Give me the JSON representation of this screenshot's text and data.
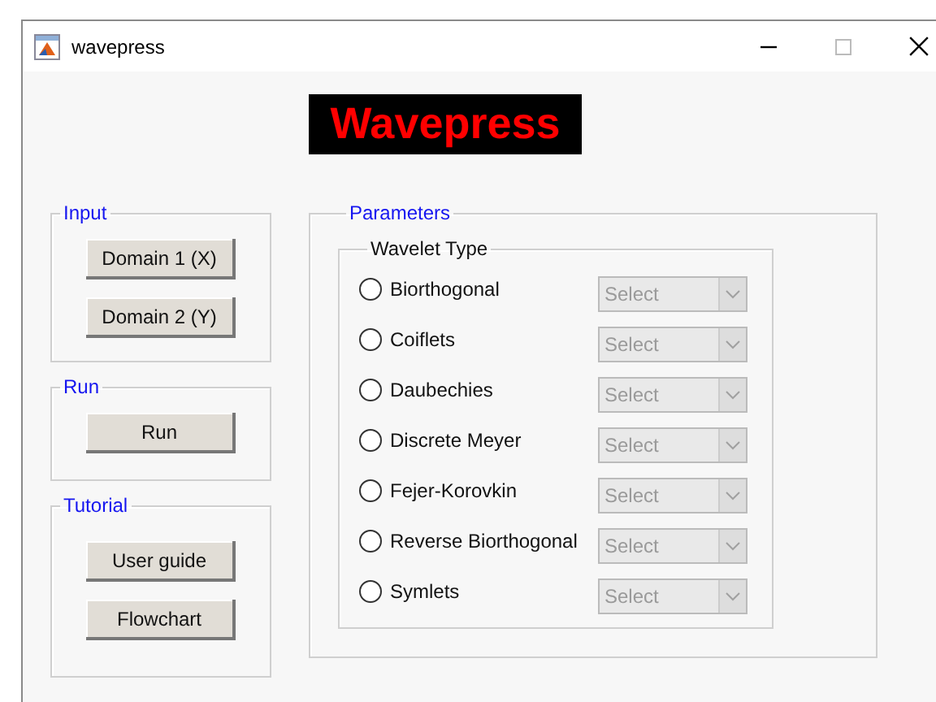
{
  "window": {
    "title": "wavepress",
    "controls": [
      {
        "kind": "minimize"
      },
      {
        "kind": "maximize"
      },
      {
        "kind": "close"
      }
    ]
  },
  "banner": "Wavepress",
  "side_panels": [
    {
      "title": "Input",
      "buttons": [
        "Domain 1 (X)",
        "Domain 2 (Y)"
      ]
    },
    {
      "title": "Run",
      "buttons": [
        "Run"
      ]
    },
    {
      "title": "Tutorial",
      "buttons": [
        "User guide",
        "Flowchart"
      ]
    }
  ],
  "parameters": {
    "title": "Parameters",
    "wavelet_type": {
      "title": "Wavelet Type",
      "options": [
        {
          "label": "Biorthogonal",
          "selected": false,
          "select": {
            "placeholder": "Select",
            "disabled": true
          }
        },
        {
          "label": "Coiflets",
          "selected": false,
          "select": {
            "placeholder": "Select",
            "disabled": true
          }
        },
        {
          "label": "Daubechies",
          "selected": false,
          "select": {
            "placeholder": "Select",
            "disabled": true
          }
        },
        {
          "label": "Discrete Meyer",
          "selected": false,
          "select": {
            "placeholder": "Select",
            "disabled": true
          }
        },
        {
          "label": "Fejer-Korovkin",
          "selected": false,
          "select": {
            "placeholder": "Select",
            "disabled": true
          }
        },
        {
          "label": "Reverse Biorthogonal",
          "selected": false,
          "select": {
            "placeholder": "Select",
            "disabled": true
          }
        },
        {
          "label": "Symlets",
          "selected": false,
          "select": {
            "placeholder": "Select",
            "disabled": true
          }
        }
      ]
    }
  }
}
